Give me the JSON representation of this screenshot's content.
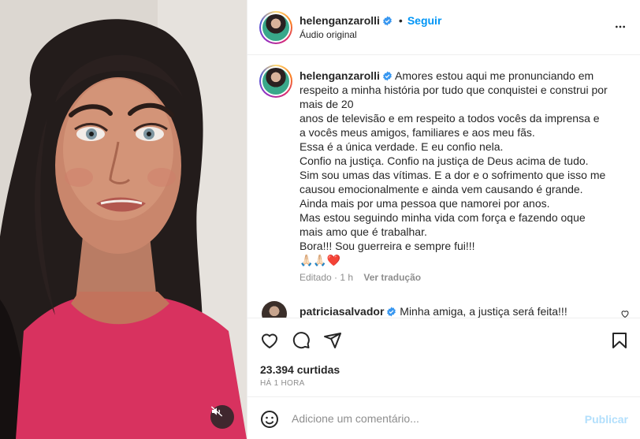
{
  "post": {
    "author": "helenganzarolli",
    "follow_label": "Seguir",
    "audio": "Áudio original",
    "separator_dot": "•"
  },
  "caption": {
    "username": "helenganzarolli",
    "first_line": "Amores estou aqui me pronunciando em respeito a minha história por tudo que conquistei e construi por mais de 20",
    "lines": [
      "anos de televisão e em respeito a todos vocês da imprensa e",
      "a vocês meus amigos, familiares e aos meu fãs.",
      "Essa é a única verdade. E eu confio nela.",
      "Confio na justiça. Confio na justiça de Deus acima de tudo.",
      "Sim sou umas das vítimas. E a dor e o sofrimento que isso me",
      "causou emocionalmente e ainda vem causando é grande.",
      "Ainda mais por uma pessoa que namorei por anos.",
      "Mas estou seguindo minha vida com força e fazendo oque",
      "mais amo que é trabalhar.",
      "Bora!!! Sou guerreira e sempre fui!!!",
      "🙏🏻🙏🏻❤️"
    ],
    "edited": "Editado",
    "time": "· 1 h",
    "translate": "Ver tradução"
  },
  "reply": {
    "username": "patriciasalvador",
    "text": "Minha amiga, a justiça será feita!!!"
  },
  "stats": {
    "likes": "23.394 curtidas",
    "posted": "HÁ 1 HORA"
  },
  "composer": {
    "placeholder": "Adicione um comentário...",
    "publish": "Publicar"
  },
  "icons": {
    "verified": "verified-badge-icon",
    "more": "more-horizontal-icon",
    "like": "heart-icon",
    "comment": "comment-icon",
    "share": "share-icon",
    "save": "bookmark-icon",
    "emoji": "emoji-icon",
    "mute": "audio-muted-icon"
  },
  "colors": {
    "accent": "#0095f6",
    "publish_disabled": "#b2dffc",
    "muted_text": "#8e8e8e",
    "verified": "#3897f0"
  }
}
